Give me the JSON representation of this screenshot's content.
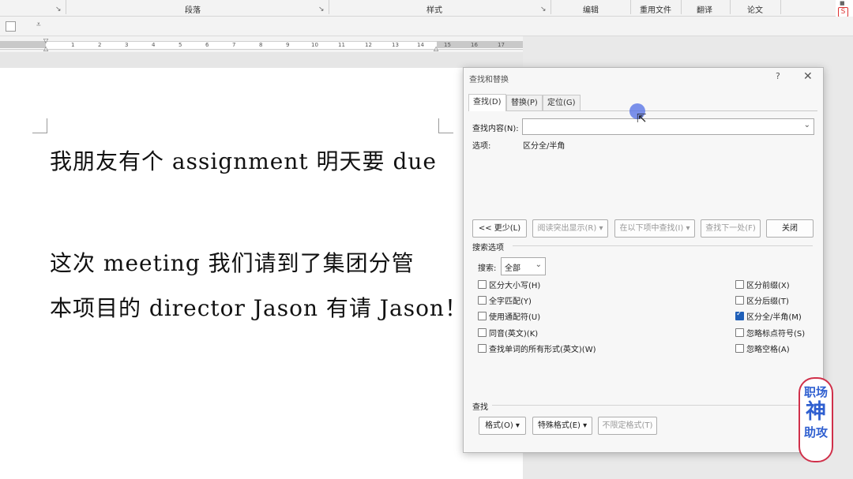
{
  "ribbon": {
    "groups": [
      {
        "label": "段落"
      },
      {
        "label": "样式"
      },
      {
        "label": "编辑"
      },
      {
        "label": "重用文件"
      },
      {
        "label": "翻译"
      },
      {
        "label": "论文"
      }
    ]
  },
  "ruler": {
    "ticks": [
      "1",
      "2",
      "3",
      "4",
      "5",
      "6",
      "7",
      "8",
      "9",
      "10",
      "11",
      "12",
      "13",
      "14",
      "15",
      "16",
      "17"
    ]
  },
  "document": {
    "lines": [
      "我朋友有个 assignment  明天要 due",
      "这次 meeting 我们请到了集团分管",
      "本项目的 director Jason  有请 Jason！"
    ]
  },
  "dialog": {
    "title": "查找和替换",
    "help": "?",
    "close": "✕",
    "tabs": [
      "查找(D)",
      "替换(P)",
      "定位(G)"
    ],
    "find_label": "查找内容(N):",
    "find_value": "",
    "options_label": "选项:",
    "options_value": "区分全/半角",
    "buttons": {
      "less": "<< 更少(L)",
      "reading_highlight": "阅读突出显示(R) ▾",
      "find_in": "在以下项中查找(I) ▾",
      "find_next": "查找下一处(F)",
      "close": "关闭"
    },
    "search_options_title": "搜索选项",
    "search_label": "搜索:",
    "search_value": "全部",
    "left_options": [
      {
        "label": "区分大小写(H)",
        "checked": false
      },
      {
        "label": "全字匹配(Y)",
        "checked": false
      },
      {
        "label": "使用通配符(U)",
        "checked": false
      },
      {
        "label": "同音(英文)(K)",
        "checked": false
      },
      {
        "label": "查找单词的所有形式(英文)(W)",
        "checked": false
      }
    ],
    "right_options": [
      {
        "label": "区分前缀(X)",
        "checked": false
      },
      {
        "label": "区分后缀(T)",
        "checked": false
      },
      {
        "label": "区分全/半角(M)",
        "checked": true
      },
      {
        "label": "忽略标点符号(S)",
        "checked": false
      },
      {
        "label": "忽略空格(A)",
        "checked": false
      }
    ],
    "find_section_title": "查找",
    "bottom_buttons": {
      "format": "格式(O) ▾",
      "special": "特殊格式(E) ▾",
      "no_format": "不限定格式(T)"
    }
  },
  "watermark": {
    "chars": [
      "职场",
      "神",
      "助攻"
    ]
  }
}
